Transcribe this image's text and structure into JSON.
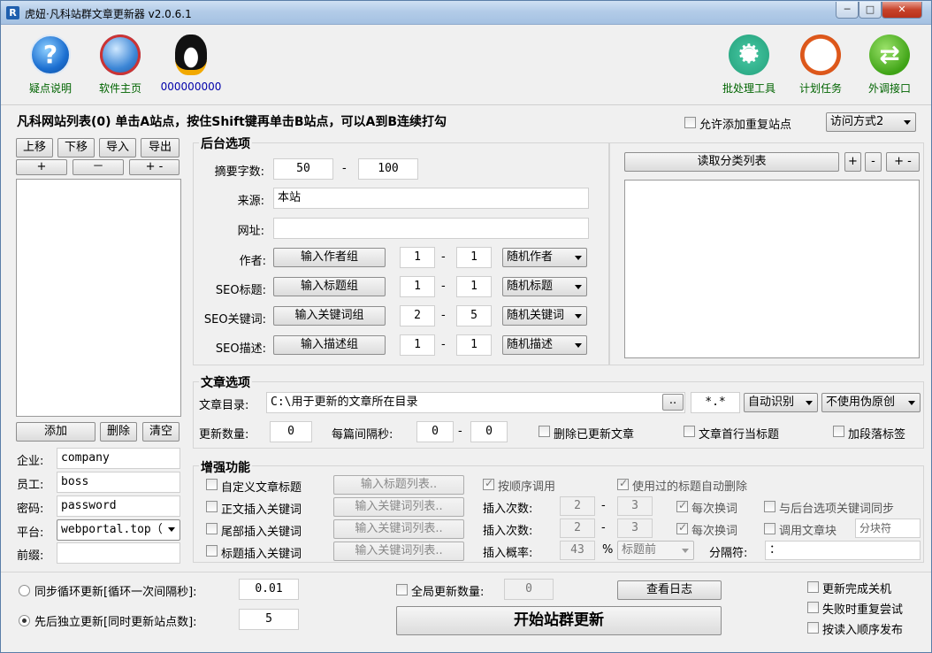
{
  "window": {
    "title": "虎妞·凡科站群文章更新器 v2.0.6.1",
    "icon": "R",
    "min": "─",
    "max": "□",
    "close": "✕"
  },
  "toolbar": {
    "left": [
      {
        "label": "疑点说明",
        "icon": "help-icon"
      },
      {
        "label": "软件主页",
        "icon": "globe-icon"
      },
      {
        "label": "000000000",
        "icon": "qq-penguin-icon"
      }
    ],
    "right": [
      {
        "label": "批处理工具",
        "icon": "gear-icon"
      },
      {
        "label": "计划任务",
        "icon": "clock-icon"
      },
      {
        "label": "外调接口",
        "icon": "swap-arrows-icon"
      }
    ]
  },
  "sites": {
    "header": "凡科网站列表(0)  单击A站点，按住Shift键再单击B站点，可以A到B连续打勾",
    "move_up": "上移",
    "move_down": "下移",
    "import": "导入",
    "export": "导出",
    "plus": "+",
    "minus": "－",
    "plusminus": "+ -",
    "add": "添加",
    "delete": "删除",
    "clear": "清空",
    "fields": [
      {
        "label": "企业:",
        "value": "company"
      },
      {
        "label": "员工:",
        "value": "boss"
      },
      {
        "label": "密码:",
        "value": "password"
      },
      {
        "label": "平台:",
        "value": "webportal.top（"
      },
      {
        "label": "前缀:",
        "value": ""
      }
    ]
  },
  "top_right": {
    "allow_duplicates": "允许添加重复站点",
    "access_mode": "访问方式2"
  },
  "backend": {
    "title": "后台选项",
    "summary_label": "摘要字数:",
    "summary_min": "50",
    "dash": "-",
    "summary_max": "100",
    "source_label": "来源:",
    "source_value": "本站",
    "url_label": "网址:",
    "url_value": "",
    "rows": [
      {
        "label": "作者:",
        "button": "输入作者组",
        "min": "1",
        "max": "1",
        "mode": "随机作者"
      },
      {
        "label": "SEO标题:",
        "button": "输入标题组",
        "min": "1",
        "max": "1",
        "mode": "随机标题"
      },
      {
        "label": "SEO关键词:",
        "button": "输入关键词组",
        "min": "2",
        "max": "5",
        "mode": "随机关键词"
      },
      {
        "label": "SEO描述:",
        "button": "输入描述组",
        "min": "1",
        "max": "1",
        "mode": "随机描述"
      }
    ]
  },
  "category": {
    "read_button": "读取分类列表",
    "plus": "+",
    "minus": "-",
    "plusminus": "+ -"
  },
  "article": {
    "title": "文章选项",
    "dir_label": "文章目录:",
    "dir_value": "C:\\用于更新的文章所在目录",
    "browse": "..",
    "ext": "*.*",
    "encoding": "自动识别",
    "pseudo": "不使用伪原创",
    "count_label": "更新数量:",
    "count_value": "0",
    "interval_label": "每篇间隔秒:",
    "interval_min": "0",
    "interval_max": "0",
    "delete_updated": "删除已更新文章",
    "first_line_title": "文章首行当标题",
    "para_tags": "加段落标签"
  },
  "enhance": {
    "title": "增强功能",
    "custom_title": "自定义文章标题",
    "custom_title_btn": "输入标题列表..",
    "in_order": "按顺序调用",
    "auto_delete_used": "使用过的标题自动删除",
    "body_kw": "正文插入关键词",
    "body_kw_btn": "输入关键词列表..",
    "insert_count": "插入次数:",
    "body_min": "2",
    "body_max": "3",
    "each_change": "每次换词",
    "sync_backend": "与后台选项关键词同步",
    "tail_kw": "尾部插入关键词",
    "tail_kw_btn": "输入关键词列表..",
    "tail_min": "2",
    "tail_max": "3",
    "use_block": "调用文章块",
    "block_placeholder": "分块符",
    "title_kw": "标题插入关键词",
    "title_kw_btn": "输入关键词列表..",
    "prob_label": "插入概率:",
    "prob_value": "43",
    "pct": "%",
    "position": "标题前",
    "separator_label": "分隔符:",
    "separator_value": "："
  },
  "bottom": {
    "sync_loop": "同步循环更新[循环一次间隔秒]:",
    "sync_value": "0.01",
    "seq_update": "先后独立更新[同时更新站点数]:",
    "seq_value": "5",
    "global_count": "全局更新数量:",
    "global_value": "0",
    "view_log": "查看日志",
    "start": "开始站群更新",
    "shutdown": "更新完成关机",
    "retry": "失败时重复尝试",
    "read_order": "按读入顺序发布"
  }
}
